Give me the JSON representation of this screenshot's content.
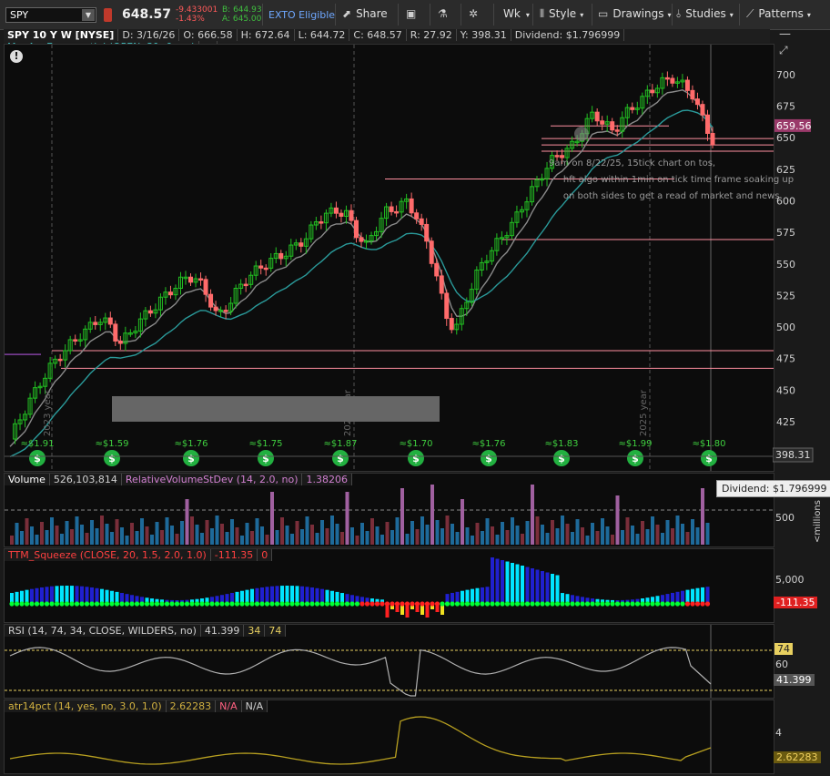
{
  "toolbar": {
    "symbol": "SPY",
    "last": "648.57",
    "change": "-9.433001",
    "change_pct": "-1.43%",
    "bid": "B: 644.93",
    "ask": "A: 645.00",
    "exto": "EXTO Eligible",
    "share": "Share",
    "period": "Wk",
    "style": "Style",
    "drawings": "Drawings",
    "studies": "Studies",
    "patterns": "Patterns"
  },
  "header": {
    "title": "SPY 10 Y W [NYSE]",
    "date": "D: 3/16/26",
    "open": "O: 666.58",
    "high": "H: 672.64",
    "low": "L: 644.72",
    "close": "C: 648.57",
    "range": "R: 27.92",
    "y": "Y: 398.31",
    "dividend": "Dividend: $1.796999",
    "ma": "MovAvgExponential (OPEN, 21, 0, no)",
    "more": "..."
  },
  "colors": {
    "up": "#22c022",
    "down": "#ff6b6b",
    "ema21": "#2a9a9a",
    "ema_grey": "#8a8a8a",
    "hline": "#ff8fa0",
    "squeeze_hi": "#00e5ff",
    "squeeze_dark": "#2020d0",
    "dot_green": "#00ff33",
    "dot_red": "#ff2020",
    "rsi": "#b0b0b0",
    "atr": "#b8a020"
  },
  "annotation": "9am on 8/22/25, 15tick chart on tos,\n     hft algo within 1min on tick time frame soaking up\n     on both sides to get a read of market and news",
  "year_markers": [
    "2023 year",
    "2024 year",
    "2025 year"
  ],
  "price_tags": {
    "last": "659.56",
    "low_label": "398.31"
  },
  "dividend_tooltip": "Dividend: $1.796999 on",
  "volume": {
    "title": "Volume",
    "value": "526,103,814",
    "study": "RelativeVolumeStDev (14, 2.0, no)",
    "study_value": "1.38206",
    "axis_unit": "<millions",
    "axis_tick": "500"
  },
  "squeeze": {
    "title": "TTM_Squeeze (CLOSE, 20, 1.5, 2.0, 1.0)",
    "value": "-111.35",
    "zero": "0",
    "axis_tick": "5,000"
  },
  "rsi": {
    "title": "RSI (14, 74, 34, CLOSE, WILDERS, no)",
    "value": "41.399",
    "ob": "34",
    "os": "74",
    "axis_ticks": [
      "74",
      "60"
    ]
  },
  "atr": {
    "title": "atr14pct (14, yes, no, 3.0, 1.0)",
    "value": "2.62283",
    "na1": "N/A",
    "na2": "N/A",
    "axis_tick": "4"
  },
  "chart_data": {
    "type": "candlestick",
    "title": "SPY 10 Y W [NYSE]",
    "ylim": [
      398.31,
      710
    ],
    "y_ticks": [
      425,
      450,
      475,
      500,
      525,
      550,
      575,
      600,
      625,
      650,
      675,
      700
    ],
    "y_axis_side": "right",
    "grid": false,
    "legend": "top-left",
    "dividends": [
      {
        "label": "≈$1.91",
        "value": 1.91
      },
      {
        "label": "≈$1.59",
        "value": 1.59
      },
      {
        "label": "≈$1.76",
        "value": 1.76
      },
      {
        "label": "≈$1.75",
        "value": 1.75
      },
      {
        "label": "≈$1.87",
        "value": 1.87
      },
      {
        "label": "≈$1.70",
        "value": 1.7
      },
      {
        "label": "≈$1.76",
        "value": 1.76
      },
      {
        "label": "≈$1.83",
        "value": 1.83
      },
      {
        "label": "≈$1.99",
        "value": 1.99
      },
      {
        "label": "≈$1.80",
        "value": 1.8
      }
    ],
    "price_path": [
      412,
      428,
      442,
      456,
      468,
      478,
      486,
      494,
      500,
      508,
      503,
      488,
      494,
      505,
      512,
      520,
      528,
      535,
      541,
      538,
      525,
      508,
      518,
      530,
      540,
      546,
      552,
      556,
      560,
      566,
      572,
      585,
      590,
      593,
      590,
      575,
      565,
      580,
      592,
      595,
      600,
      590,
      570,
      545,
      510,
      498,
      520,
      540,
      555,
      565,
      575,
      585,
      600,
      612,
      625,
      635,
      640,
      645,
      660,
      670,
      662,
      655,
      668,
      675,
      682,
      690,
      695,
      698,
      692,
      685,
      665,
      648
    ],
    "horizontal_levels": [
      482,
      468,
      618,
      570,
      640,
      645,
      650,
      660
    ]
  }
}
